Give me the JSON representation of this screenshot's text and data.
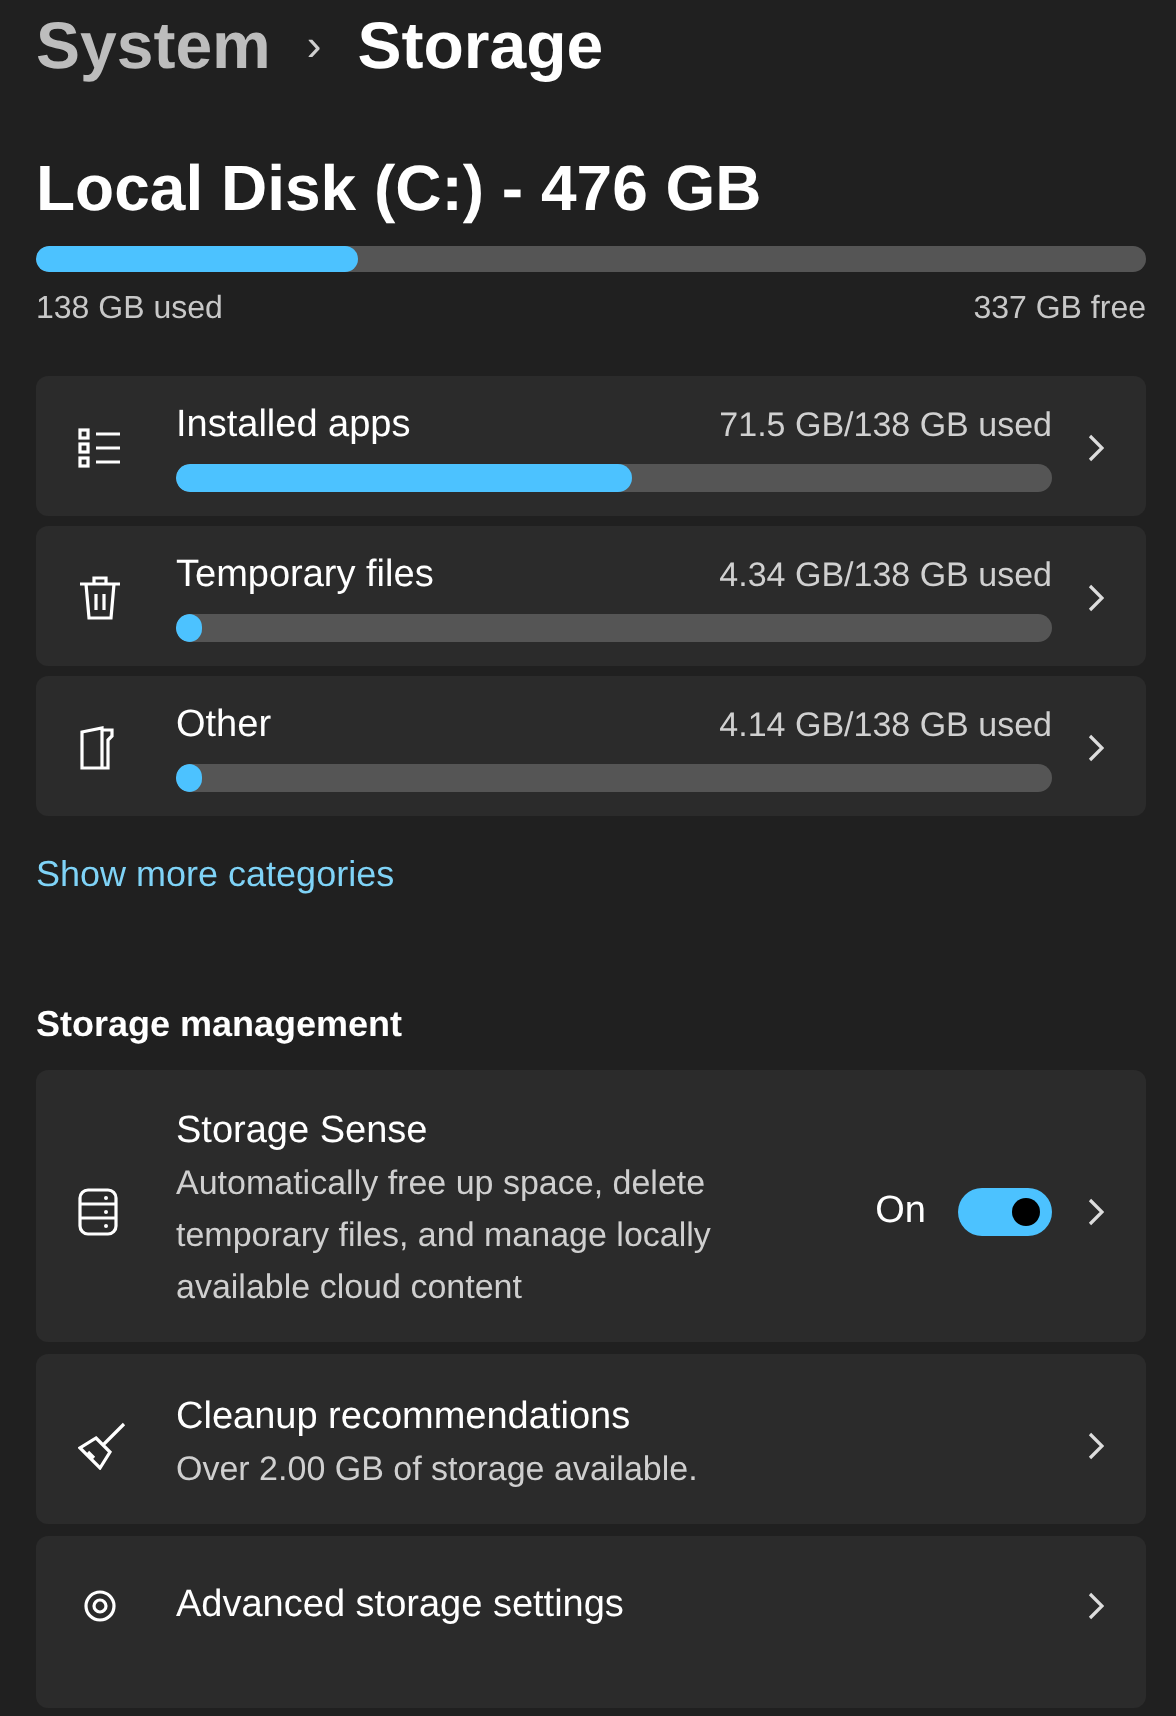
{
  "breadcrumb": {
    "parent": "System",
    "separator": "›",
    "current": "Storage"
  },
  "disk": {
    "title": "Local Disk (C:) - 476 GB",
    "level": 0.29,
    "used": "138 GB used",
    "free": "337 GB free"
  },
  "categories": [
    {
      "kind": "apps",
      "label": "Installed apps",
      "usage": "71.5 GB/138 GB used",
      "level": 0.52
    },
    {
      "kind": "temp",
      "label": "Temporary files",
      "usage": "4.34 GB/138 GB used",
      "level": 0.03
    },
    {
      "kind": "other",
      "label": "Other",
      "usage": "4.14 GB/138 GB used",
      "level": 0.03
    }
  ],
  "show_more": "Show more categories",
  "management": {
    "heading": "Storage management",
    "items": [
      {
        "kind": "sense",
        "title": "Storage Sense",
        "description": "Automatically free up space, delete temporary files, and manage locally available cloud content",
        "toggle": {
          "label": "On",
          "on": true
        }
      },
      {
        "kind": "cleanup",
        "title": "Cleanup recommendations",
        "description": "Over 2.00 GB of storage available."
      },
      {
        "kind": "advanced",
        "title": "Advanced storage settings"
      }
    ]
  }
}
